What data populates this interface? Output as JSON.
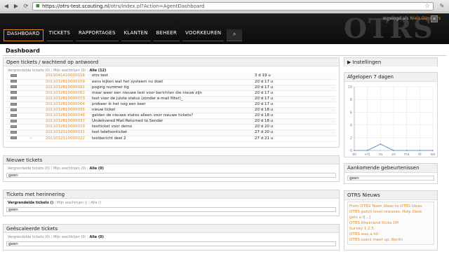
{
  "browser": {
    "url_host": "https://otrs-test.scouting.nl",
    "url_path": "/otrs/index.pl?Action=AgentDashboard"
  },
  "header": {
    "logo": "OTRS",
    "login_prefix": "Ingelogd als",
    "user": "Niels Dimmers",
    "menu": [
      "DASHBOARD",
      "TICKETS",
      "RAPPORTAGES",
      "KLANTEN",
      "BEHEER",
      "VOORKEUREN"
    ]
  },
  "page": {
    "title": "Dashboard"
  },
  "open_tickets": {
    "title": "Open tickets / wachtend op antwoord",
    "filters": [
      "Vergrendelde tickets (0)",
      "Mijn wachtrijen (0)",
      "Alle (12)"
    ],
    "rows": [
      {
        "number": "2011041410000016",
        "title": "otrs test",
        "age": "3 d 19 u"
      },
      {
        "number": "2011032810000109",
        "title": "eens kijken wat het systeem nu doet",
        "age": "20 d 17 u"
      },
      {
        "number": "2011032810000091",
        "title": "poging nummer tig",
        "age": "20 d 17 u"
      },
      {
        "number": "2011032810000082",
        "title": "maar weer een nieuwe test voor berichten die nieuw zijn",
        "age": "20 d 17 u"
      },
      {
        "number": "2011032810000073",
        "title": "test voor de juiste status (zonder e-mail filter)_",
        "age": "20 d 17 u"
      },
      {
        "number": "2011032810000064",
        "title": "probeer ik het nog een keer",
        "age": "20 d 17 u"
      },
      {
        "number": "2011032810000055",
        "title": "nieuw ticket",
        "age": "20 d 18 u"
      },
      {
        "number": "2011032810000046",
        "title": "gelden de nieuwe states alleen voor nieuwe tickets?",
        "age": "20 d 18 u"
      },
      {
        "number": "2011032810000037",
        "title": "Undelivered Mail Returned to Sender",
        "age": "20 d 18 u"
      },
      {
        "number": "2011032810000019",
        "title": "testticket voor demo",
        "age": "20 d 20 u"
      },
      {
        "number": "2011032110000031",
        "title": "test telefoonticket",
        "age": "27 d 20 u"
      },
      {
        "number": "2011032110000022",
        "title": "testbericht deel 2",
        "age": "27 d 21 u"
      }
    ]
  },
  "new_tickets": {
    "title": "Nieuwe tickets",
    "filters": [
      "Vergrendelde tickets (0)",
      "Mijn wachtrijen (0)",
      "Alle (0)"
    ],
    "empty": "geen"
  },
  "reminder_tickets": {
    "title": "Tickets met herinnering",
    "filters": [
      "Vergrendelde tickets ()",
      "Mijn wachtrijen ()",
      "Alle ()"
    ],
    "empty": "geen"
  },
  "escalated_tickets": {
    "title": "Geëscaleerde tickets",
    "filters": [
      "Vergrendelde tickets (0)",
      "Mijn wachtrijen (0)",
      "Alle (0)"
    ],
    "empty": "geen"
  },
  "sidebar": {
    "settings": "Instellingen",
    "chart_title": "Afgelopen 7 dagen",
    "events_title": "Aankomende gebeurtenissen",
    "events_empty": "geen",
    "news_title": "OTRS Nieuws",
    "news": [
      "From OTRS Team Ideas to OTRS Ideas",
      "OTRS patch level releases: Help Desk",
      "gets a t[...]",
      "OTRS Rheinland Kicks Off",
      "Survey 1.2.5",
      "OTRS was a hit",
      "OTRS users meet up: Berlin"
    ]
  },
  "chart_data": {
    "type": "line",
    "categories": [
      "do",
      "vrij",
      "za",
      "zo",
      "ma",
      "di",
      "wo"
    ],
    "series": [
      {
        "values": [
          0,
          0,
          1,
          0,
          0,
          0,
          0
        ],
        "color": "#6a8fd0"
      },
      {
        "values": [
          0,
          0,
          0,
          0,
          0,
          0,
          0
        ],
        "color": "#c0c0c0"
      }
    ],
    "ylim": [
      0,
      10
    ],
    "yticks": [
      0,
      2,
      4,
      6,
      8,
      10
    ],
    "xtick_labels": [
      "do",
      "vrij",
      "za",
      "zo",
      "ma",
      "di",
      "wo"
    ]
  }
}
